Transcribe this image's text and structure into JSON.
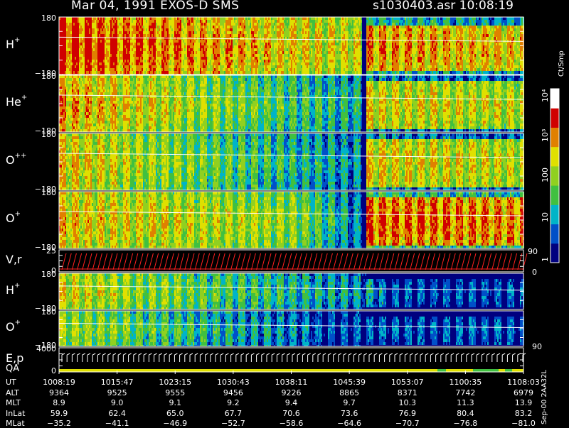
{
  "header": {
    "title": "Mar 04, 1991   EXOS-D SMS",
    "file_info": "s1030403.asr  10:08:19"
  },
  "panels": [
    {
      "label": "H",
      "sup": "+",
      "ymax": "180",
      "ymin": "−180"
    },
    {
      "label": "He",
      "sup": "+",
      "ymax": "180",
      "ymin": "−180"
    },
    {
      "label": "O",
      "sup": "++",
      "ymax": "180",
      "ymin": "−180"
    },
    {
      "label": "O",
      "sup": "+",
      "ymax": "180",
      "ymin": "−180"
    },
    {
      "label": "V,r",
      "sup": "",
      "ymax": "25",
      "ymin": "0",
      "right_top": "90",
      "right_bottom": "0"
    },
    {
      "label": "H",
      "sup": "+",
      "ymax": "180",
      "ymin": "−180"
    },
    {
      "label": "O",
      "sup": "+",
      "ymax": "180",
      "ymin": "−180",
      "right_bottom": "90"
    },
    {
      "label": "E,p",
      "sub_label": "QA",
      "ymax": "4000",
      "ymin": "0"
    }
  ],
  "colorbar": {
    "unit": "Ct/Smp",
    "ticks": [
      "1",
      "10",
      "100",
      "10³",
      "10⁴"
    ],
    "colors": [
      "#00007f",
      "#0050c8",
      "#00b4c8",
      "#40c040",
      "#90d020",
      "#e0e000",
      "#e08000",
      "#d00000",
      "#ffffff"
    ]
  },
  "chart_data": {
    "type": "heatmap",
    "title": "Mar 04, 1991   EXOS-D SMS",
    "x_axis": "UT",
    "rows": [
      {
        "name": "UT",
        "values": [
          "1008:19",
          "1015:47",
          "1023:15",
          "1030:43",
          "1038:11",
          "1045:39",
          "1053:07",
          "1100:35",
          "1108:03"
        ]
      },
      {
        "name": "ALT",
        "values": [
          "9364",
          "9525",
          "9555",
          "9456",
          "9226",
          "8865",
          "8371",
          "7742",
          "6979"
        ]
      },
      {
        "name": "MLT",
        "values": [
          "8.9",
          "9.0",
          "9.1",
          "9.2",
          "9.4",
          "9.7",
          "10.3",
          "11.3",
          "13.9"
        ]
      },
      {
        "name": "InLat",
        "values": [
          "59.9",
          "62.4",
          "65.0",
          "67.7",
          "70.6",
          "73.6",
          "76.9",
          "80.4",
          "83.2"
        ]
      },
      {
        "name": "MLat",
        "values": [
          "−35.2",
          "−41.1",
          "−46.9",
          "−52.7",
          "−58.6",
          "−64.6",
          "−70.7",
          "−76.8",
          "−81.0"
        ]
      }
    ],
    "colorbar_label": "Ct/Smp",
    "colorbar_scale": "log",
    "colorbar_range": [
      1,
      10000
    ]
  },
  "footer": "Sep-00  2AA32L"
}
